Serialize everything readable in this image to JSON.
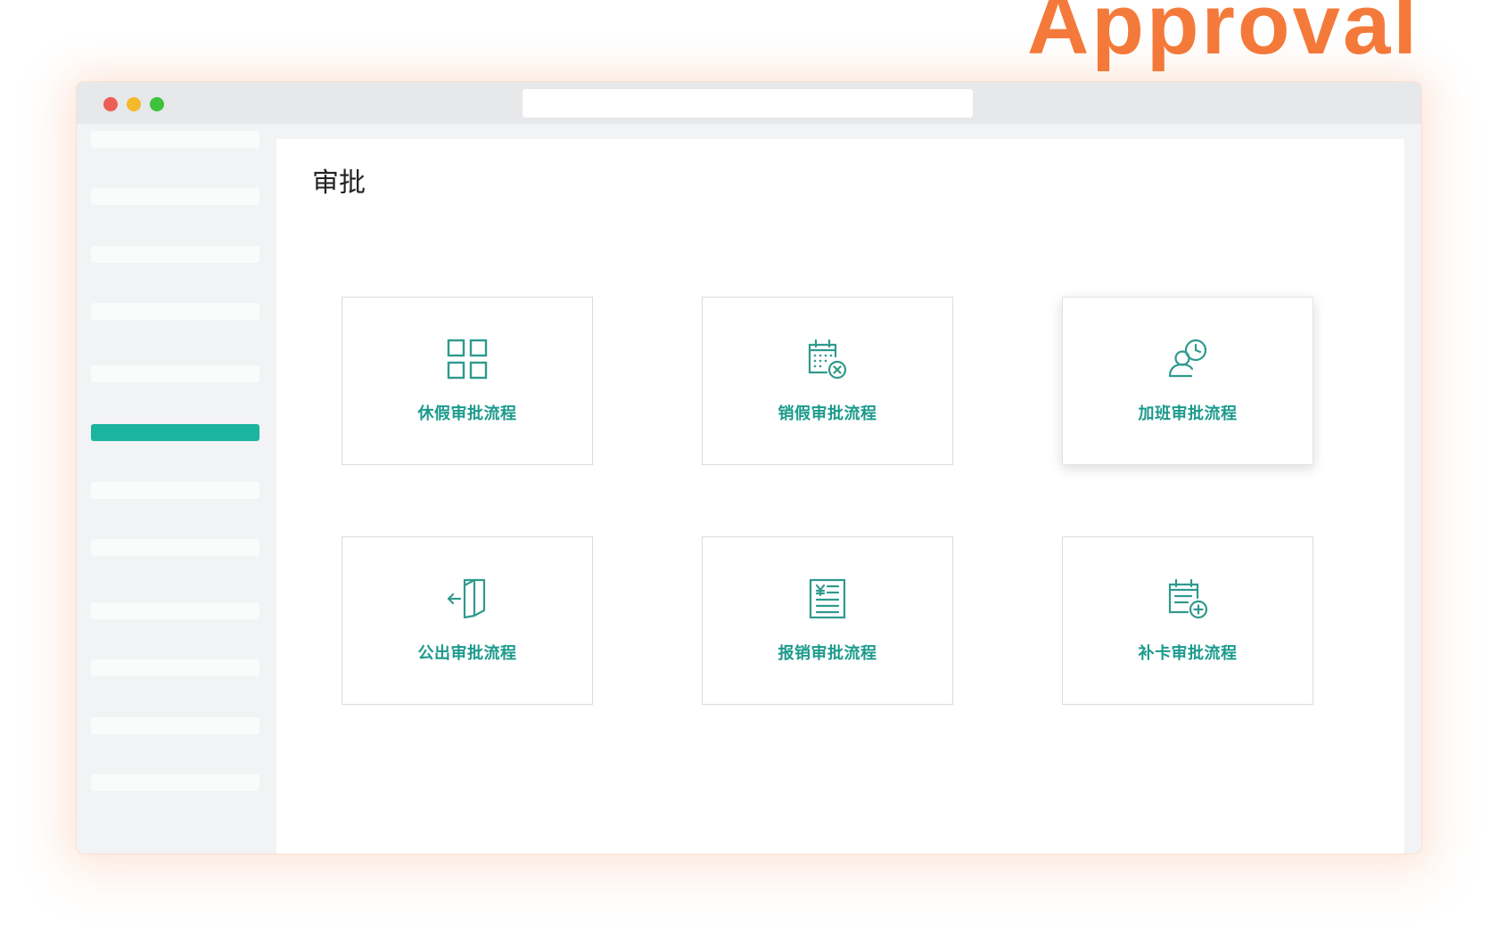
{
  "heading": "Approval",
  "page": {
    "title": "审批"
  },
  "sidebar": {
    "active_index": 5,
    "item_count": 12
  },
  "cards": [
    {
      "label": "休假审批流程",
      "icon": "grid-icon"
    },
    {
      "label": "销假审批流程",
      "icon": "calendar-cancel-icon"
    },
    {
      "label": "加班审批流程",
      "icon": "user-clock-icon"
    },
    {
      "label": "公出审批流程",
      "icon": "door-exit-icon"
    },
    {
      "label": "报销审批流程",
      "icon": "expense-receipt-icon"
    },
    {
      "label": "补卡审批流程",
      "icon": "calendar-add-icon"
    }
  ],
  "colors": {
    "accent": "#1ab4a0",
    "label_text": "#1b9a8c",
    "icon_stroke": "#2f9a8d",
    "heading": "#F47A3B"
  }
}
